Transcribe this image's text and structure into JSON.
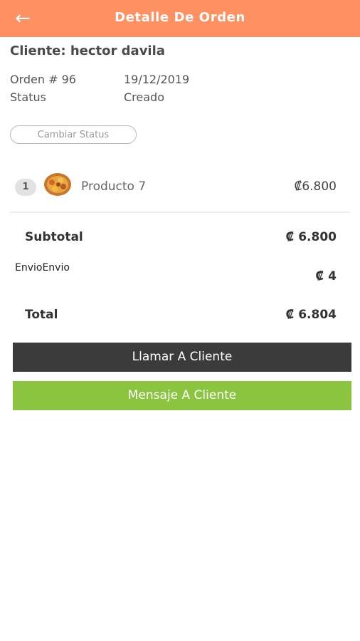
{
  "header": {
    "title": "Detalle De Orden",
    "back_icon": "arrow-left-icon",
    "background_color": "#fe9162"
  },
  "customer": {
    "label_text": "Cliente: hector davila"
  },
  "order": {
    "number_label": "Orden # 96",
    "date": "19/12/2019",
    "status_label": "Status",
    "status_value": "Creado",
    "change_status_button": "Cambiar Status"
  },
  "items": [
    {
      "qty": "1",
      "image_icon": "food-thumbnail",
      "name": "Producto 7",
      "price": "₡6.800"
    }
  ],
  "summary": {
    "subtotal_label": "Subtotal",
    "subtotal_value": "₡ 6.800",
    "envio_label": "EnvioEnvio",
    "envio_value": "₡ 4",
    "total_label": "Total",
    "total_value": "₡ 6.804"
  },
  "actions": {
    "call_label": "Llamar A Cliente",
    "call_color": "#3b3b3b",
    "message_label": "Mensaje A Cliente",
    "message_color": "#8bc43f"
  }
}
